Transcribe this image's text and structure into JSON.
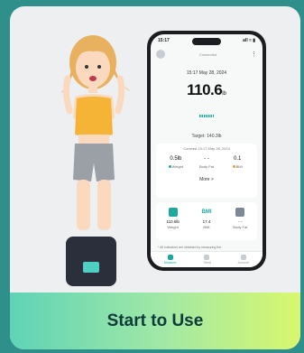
{
  "phone": {
    "status_time": "15:17",
    "status_right": "all ≈ ▮",
    "topbar_title": "Connected",
    "date": "15:17 May 28, 2024",
    "weight_value": "110.6",
    "weight_unit": "lb",
    "target": "Target: 140.3lb",
    "compared": "Contrast 15:17 May 28, 2024",
    "metrics": [
      {
        "value": "0.5lb",
        "label": "Weight"
      },
      {
        "value": "- -",
        "label": "Body Fat"
      },
      {
        "value": "0.1",
        "label": "BMI"
      }
    ],
    "more": "More >",
    "tiles": [
      {
        "icon": "weight-icon",
        "value": "110.6lb",
        "label": "Weight"
      },
      {
        "icon": "BMI",
        "value": "17.4",
        "label": "BMI"
      },
      {
        "icon": "body-fat-icon",
        "value": "- -",
        "label": "Body Fat"
      }
    ],
    "footnote": "* All indicators are obtained by measuring the",
    "tabs": [
      "Measure",
      "Trend",
      "Account"
    ]
  },
  "colors": {
    "accent": "#1ea99f",
    "background": "#2f8f8b"
  },
  "button_label": "Start to Use"
}
